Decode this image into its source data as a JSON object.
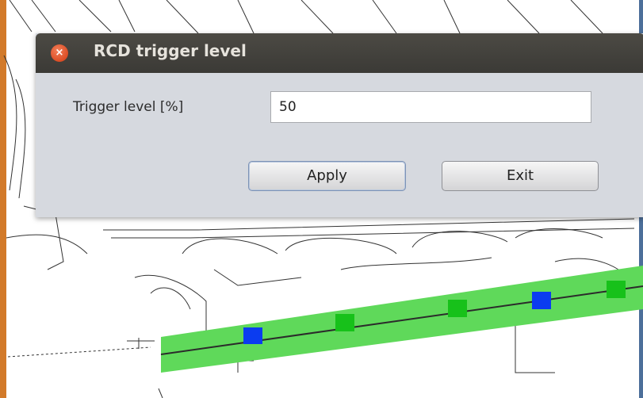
{
  "dialog": {
    "title": "RCD trigger level",
    "close_icon_glyph": "×",
    "trigger_label": "Trigger level [%]",
    "trigger_value": "50",
    "apply_label": "Apply",
    "exit_label": "Exit"
  },
  "map": {
    "runway_color": "#5fd95a",
    "marker_green": "#17c11a",
    "marker_blue": "#0b3cf0",
    "line_color": "#2b2b2b"
  }
}
